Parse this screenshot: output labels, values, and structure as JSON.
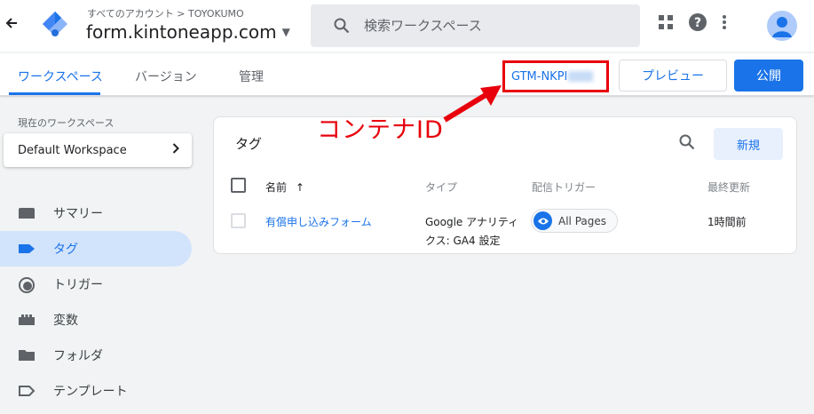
{
  "header": {
    "account_path": "すべてのアカウント > TOYOKUMO",
    "container_name": "form.kintoneapp.com",
    "search_placeholder": "検索ワークスペース"
  },
  "tabs": [
    {
      "label": "ワークスペース"
    },
    {
      "label": "バージョン"
    },
    {
      "label": "管理"
    }
  ],
  "container_id": "GTM-NKPI",
  "buttons": {
    "preview": "プレビュー",
    "publish": "公開"
  },
  "workspace": {
    "label": "現在のワークスペース",
    "name": "Default Workspace"
  },
  "sidebar": {
    "items": [
      {
        "label": "サマリー",
        "icon": "summary-icon"
      },
      {
        "label": "タグ",
        "icon": "tag-icon"
      },
      {
        "label": "トリガー",
        "icon": "trigger-icon"
      },
      {
        "label": "変数",
        "icon": "variable-icon"
      },
      {
        "label": "フォルダ",
        "icon": "folder-icon"
      },
      {
        "label": "テンプレート",
        "icon": "template-icon"
      }
    ],
    "active_index": 1
  },
  "tags_card": {
    "title": "タグ",
    "new_button": "新規",
    "columns": [
      "名前",
      "タイプ",
      "配信トリガー",
      "最終更新"
    ],
    "sort_indicator": "↑",
    "rows": [
      {
        "name": "有償申し込みフォーム",
        "type_line1": "Google アナリティ",
        "type_line2": "クス: GA4 設定",
        "trigger": "All Pages",
        "updated": "1時間前"
      }
    ]
  },
  "annotation": {
    "text": "コンテナID",
    "color": "#e8000b"
  },
  "colors": {
    "accent": "#1a73e8",
    "annotation_red": "#e8000b"
  }
}
